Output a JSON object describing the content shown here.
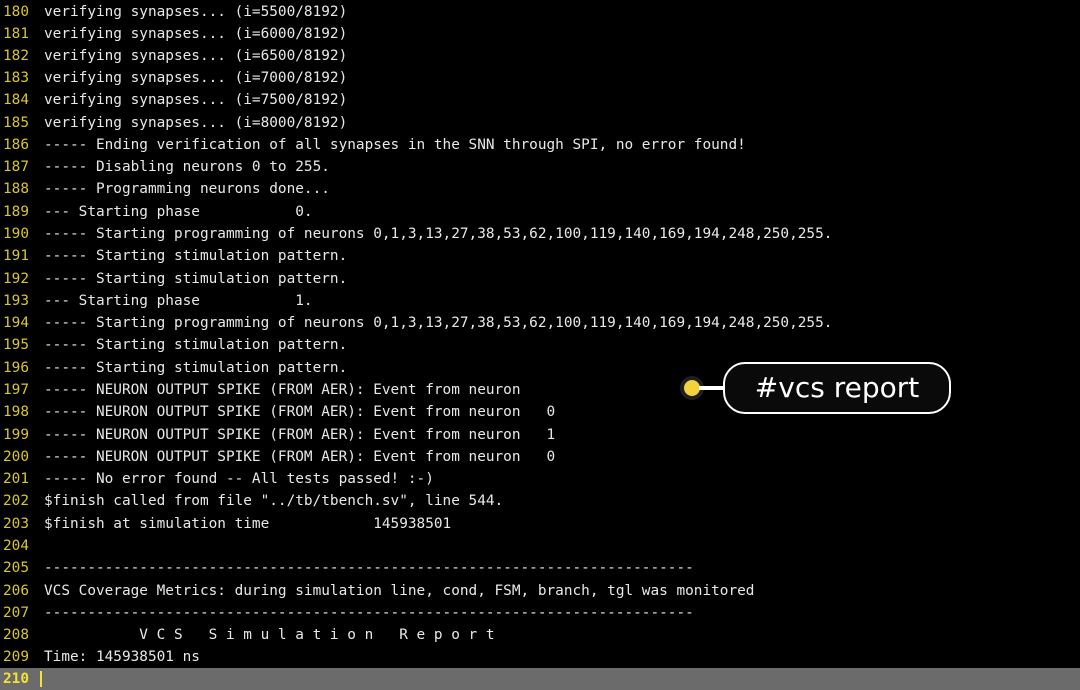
{
  "terminal": {
    "lines": [
      {
        "n": "180",
        "t": "verifying synapses... (i=5500/8192)"
      },
      {
        "n": "181",
        "t": "verifying synapses... (i=6000/8192)"
      },
      {
        "n": "182",
        "t": "verifying synapses... (i=6500/8192)"
      },
      {
        "n": "183",
        "t": "verifying synapses... (i=7000/8192)"
      },
      {
        "n": "184",
        "t": "verifying synapses... (i=7500/8192)"
      },
      {
        "n": "185",
        "t": "verifying synapses... (i=8000/8192)"
      },
      {
        "n": "186",
        "t": "----- Ending verification of all synapses in the SNN through SPI, no error found!"
      },
      {
        "n": "187",
        "t": "----- Disabling neurons 0 to 255."
      },
      {
        "n": "188",
        "t": "----- Programming neurons done..."
      },
      {
        "n": "189",
        "t": "--- Starting phase           0."
      },
      {
        "n": "190",
        "t": "----- Starting programming of neurons 0,1,3,13,27,38,53,62,100,119,140,169,194,248,250,255."
      },
      {
        "n": "191",
        "t": "----- Starting stimulation pattern."
      },
      {
        "n": "192",
        "t": "----- Starting stimulation pattern."
      },
      {
        "n": "193",
        "t": "--- Starting phase           1."
      },
      {
        "n": "194",
        "t": "----- Starting programming of neurons 0,1,3,13,27,38,53,62,100,119,140,169,194,248,250,255."
      },
      {
        "n": "195",
        "t": "----- Starting stimulation pattern."
      },
      {
        "n": "196",
        "t": "----- Starting stimulation pattern."
      },
      {
        "n": "197",
        "t": "----- NEURON OUTPUT SPIKE (FROM AER): Event from neuron"
      },
      {
        "n": "198",
        "t": "----- NEURON OUTPUT SPIKE (FROM AER): Event from neuron   0"
      },
      {
        "n": "199",
        "t": "----- NEURON OUTPUT SPIKE (FROM AER): Event from neuron   1"
      },
      {
        "n": "200",
        "t": "----- NEURON OUTPUT SPIKE (FROM AER): Event from neuron   0"
      },
      {
        "n": "201",
        "t": "----- No error found -- All tests passed! :-)"
      },
      {
        "n": "202",
        "t": "$finish called from file \"../tb/tbench.sv\", line 544."
      },
      {
        "n": "203",
        "t": "$finish at simulation time            145938501"
      },
      {
        "n": "204",
        "t": ""
      },
      {
        "n": "205",
        "t": "---------------------------------------------------------------------------"
      },
      {
        "n": "206",
        "t": "VCS Coverage Metrics: during simulation line, cond, FSM, branch, tgl was monitored"
      },
      {
        "n": "207",
        "t": "---------------------------------------------------------------------------"
      },
      {
        "n": "208",
        "t": "           V C S   S i m u l a t i o n   R e p o r t"
      },
      {
        "n": "209",
        "t": "Time: 145938501 ns"
      }
    ],
    "current_line": {
      "n": "210",
      "t": ""
    }
  },
  "callout": {
    "label": "#vcs report",
    "dot_color": "#f4d23a"
  },
  "colors": {
    "background": "#000000",
    "text": "#e8e8e8",
    "line_number": "#d9c72a",
    "status_bar": "#6b6b6b"
  }
}
